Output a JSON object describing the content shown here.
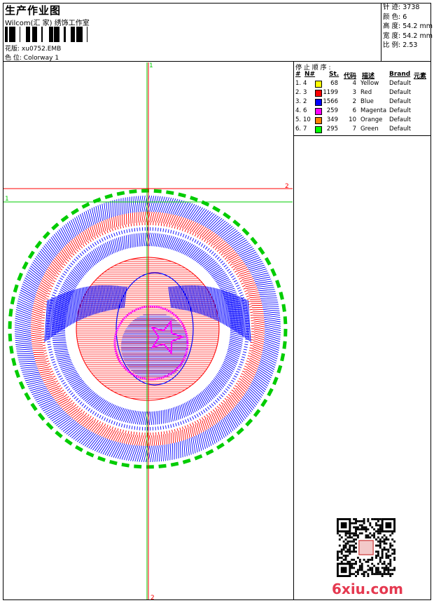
{
  "header": {
    "title": "生产作业图",
    "company": "Wilcom(汇 家) 绣饰工作室",
    "design_label": "花版:",
    "design_value": "xu0752.EMB",
    "colorway_label": "色 位:",
    "colorway_value": "Colorway 1"
  },
  "stats": {
    "stitches_label": "针 迹:",
    "stitches": "3738",
    "colors_label": "颜 色:",
    "colors": "6",
    "height_label": "高 度:",
    "height": "54.2 mm",
    "width_label": "宽 度:",
    "width": "54.2 mm",
    "scale_label": "比 例:",
    "scale": "2.53"
  },
  "stop_sequence": {
    "title": "停 止 顺 序 :",
    "columns": [
      "#",
      "N#",
      "St.",
      "代码",
      "描述",
      "Brand",
      "元素"
    ],
    "rows": [
      {
        "idx": "1.",
        "n": "4",
        "color": "#ffff00",
        "st": "68",
        "code": "4",
        "desc": "Yellow",
        "brand": "Default"
      },
      {
        "idx": "2.",
        "n": "3",
        "color": "#ff0000",
        "st": "1199",
        "code": "3",
        "desc": "Red",
        "brand": "Default"
      },
      {
        "idx": "3.",
        "n": "2",
        "color": "#0000ff",
        "st": "1566",
        "code": "2",
        "desc": "Blue",
        "brand": "Default"
      },
      {
        "idx": "4.",
        "n": "6",
        "color": "#ff00ff",
        "st": "259",
        "code": "6",
        "desc": "Magenta",
        "brand": "Default"
      },
      {
        "idx": "5.",
        "n": "10",
        "color": "#ff8000",
        "st": "349",
        "code": "10",
        "desc": "Orange",
        "brand": "Default"
      },
      {
        "idx": "6.",
        "n": "7",
        "color": "#00ff00",
        "st": "295",
        "code": "7",
        "desc": "Green",
        "brand": "Default"
      }
    ]
  },
  "guides": {
    "v_top": "1",
    "v_bottom": "2",
    "h_red": "2",
    "h_green": "1"
  },
  "watermark": {
    "logo": "6xiu.com",
    "qr_icon": "qr-code-icon"
  },
  "colors": {
    "red": "#ff0000",
    "blue": "#0000ff",
    "green": "#00cc00",
    "magenta": "#ff00ff"
  }
}
